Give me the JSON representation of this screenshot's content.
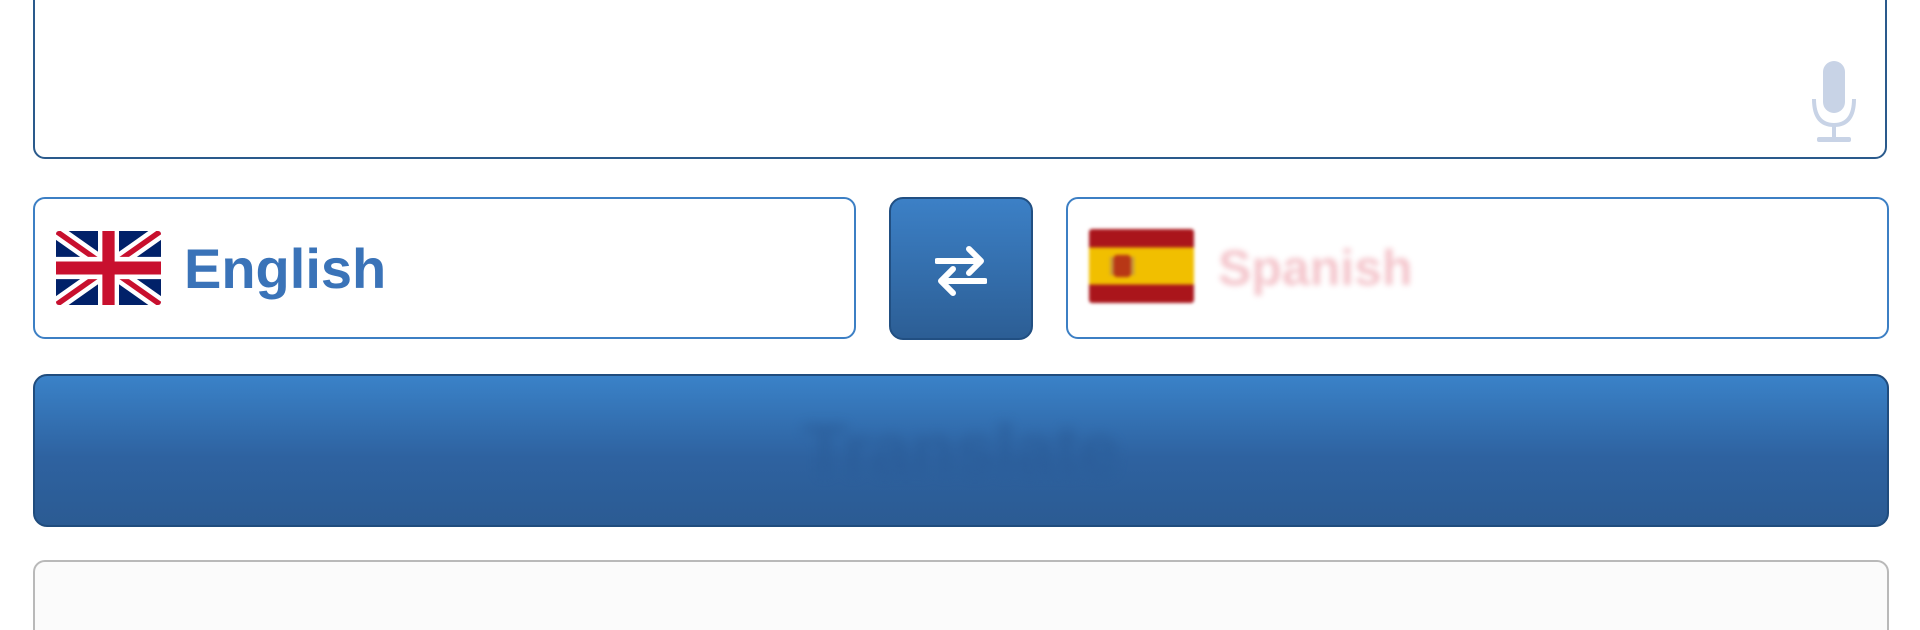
{
  "source": {
    "text": "",
    "mic_icon": "microphone-icon"
  },
  "languages": {
    "from": {
      "label": "English",
      "flag_icon": "uk-flag-icon"
    },
    "to": {
      "label": "Spanish",
      "flag_icon": "spain-flag-icon"
    },
    "swap_icon": "swap-arrows-icon"
  },
  "translate_button": {
    "label": "Translate"
  },
  "output": {
    "text": ""
  },
  "colors": {
    "accent": "#3c7fc4",
    "button_dark": "#2c5e95",
    "label_blue": "#3a73b8"
  }
}
